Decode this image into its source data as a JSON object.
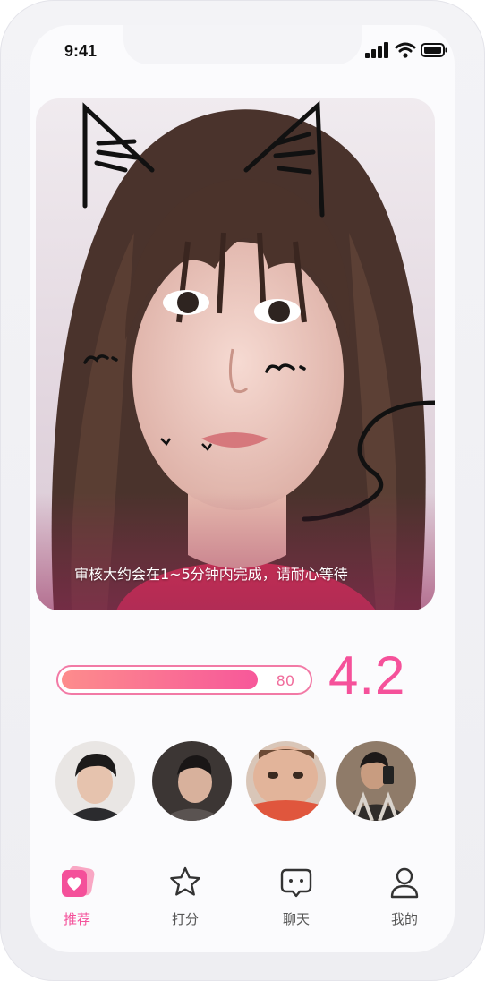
{
  "status_bar": {
    "time": "9:41"
  },
  "photo_card": {
    "review_notice": "审核大约会在1~5分钟内完成，请耐心等待"
  },
  "score": {
    "progress": 80,
    "progress_label": "80",
    "rating": "4.2"
  },
  "avatars": [
    {
      "name": "avatar-1"
    },
    {
      "name": "avatar-2"
    },
    {
      "name": "avatar-3"
    },
    {
      "name": "avatar-4"
    }
  ],
  "nav": {
    "items": [
      {
        "label": "推荐",
        "icon": "heart-card-icon",
        "active": true
      },
      {
        "label": "打分",
        "icon": "star-icon",
        "active": false
      },
      {
        "label": "聊天",
        "icon": "chat-bubble-icon",
        "active": false
      },
      {
        "label": "我的",
        "icon": "person-icon",
        "active": false
      }
    ]
  },
  "colors": {
    "accent": "#f5519a",
    "progress_start": "#fd8c8c",
    "progress_end": "#f7589a"
  }
}
